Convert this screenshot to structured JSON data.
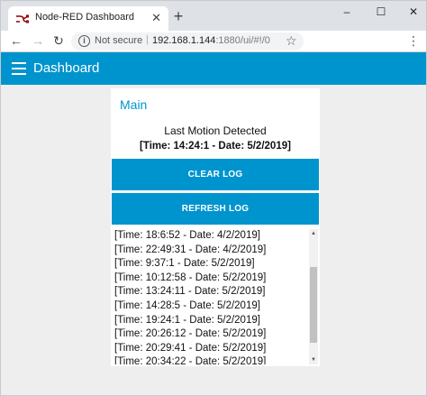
{
  "browser": {
    "tab_title": "Node-RED Dashboard",
    "tab_close": "✕",
    "new_tab": "+",
    "window_buttons": {
      "minimize": "–",
      "maximize": "☐",
      "close": "✕"
    },
    "nav": {
      "back": "←",
      "forward": "→",
      "reload": "↻"
    },
    "security_text": "Not secure",
    "separator": "|",
    "url_host": "192.168.1.144",
    "url_rest": ":1880/ui/#!/0",
    "bookmark_icon": "☆",
    "menu_icon": "⋮"
  },
  "header": {
    "title": "Dashboard",
    "background": "#0094ce"
  },
  "card": {
    "group_title": "Main",
    "motion_label": "Last Motion Detected",
    "motion_value": "[Time: 14:24:1 - Date: 5/2/2019]",
    "clear_button": "CLEAR LOG",
    "refresh_button": "REFRESH LOG",
    "log": [
      "[Time: 18:6:52 - Date: 4/2/2019]",
      "[Time: 22:49:31 - Date: 4/2/2019]",
      "[Time: 9:37:1 - Date: 5/2/2019]",
      "[Time: 10:12:58 - Date: 5/2/2019]",
      "[Time: 13:24:11 - Date: 5/2/2019]",
      "[Time: 14:28:5 - Date: 5/2/2019]",
      "[Time: 19:24:1 - Date: 5/2/2019]",
      "[Time: 20:26:12 - Date: 5/2/2019]",
      "[Time: 20:29:41 - Date: 5/2/2019]",
      "[Time: 20:34:22 - Date: 5/2/2019]"
    ],
    "log_scroll_position": 0.7
  },
  "icons": {
    "scroll_up": "▲",
    "scroll_down": "▼"
  }
}
